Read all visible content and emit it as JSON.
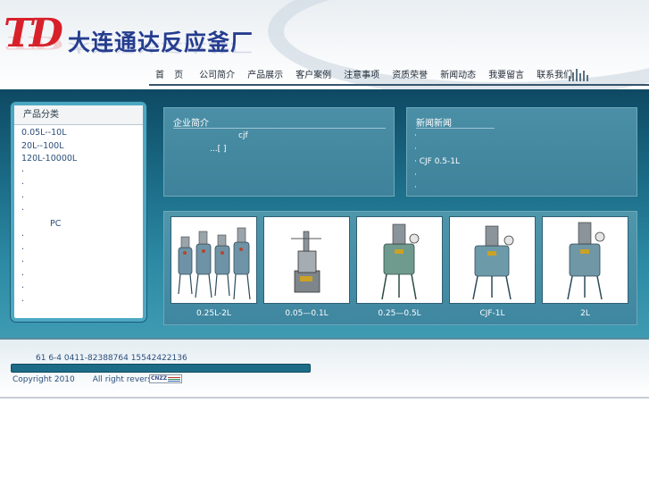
{
  "brand": {
    "logo_mark": "TD",
    "company_name": "大连通达反应釜厂"
  },
  "nav": {
    "items": [
      {
        "label": "首 页"
      },
      {
        "label": "公司简介"
      },
      {
        "label": "产品展示"
      },
      {
        "label": "客户案例"
      },
      {
        "label": "注意事项"
      },
      {
        "label": "资质荣誉"
      },
      {
        "label": "新闻动态"
      },
      {
        "label": "我要留言"
      },
      {
        "label": "联系我们"
      }
    ]
  },
  "categories": {
    "title": "产品分类",
    "items": [
      {
        "label": "0.05L--10L"
      },
      {
        "label": "20L--100L"
      },
      {
        "label": "120L-10000L"
      },
      {
        "label": "·"
      },
      {
        "label": "·"
      },
      {
        "label": "·"
      },
      {
        "label": "·"
      },
      {
        "label": "PC"
      },
      {
        "label": "·"
      },
      {
        "label": "·"
      },
      {
        "label": "·"
      },
      {
        "label": "·"
      },
      {
        "label": "·"
      },
      {
        "label": "·"
      }
    ]
  },
  "intro": {
    "title": "企业简介",
    "line1": "cjf",
    "more": "...[ ]"
  },
  "news": {
    "title": "新闻新闻",
    "items": [
      {
        "label": "·"
      },
      {
        "label": "·"
      },
      {
        "label": "·  CJF  0.5-1L"
      },
      {
        "label": "·"
      },
      {
        "label": "·"
      }
    ]
  },
  "products": [
    {
      "caption": "0.25L-2L"
    },
    {
      "caption": "0.05—0.1L"
    },
    {
      "caption": "0.25—0.5L"
    },
    {
      "caption": "CJF-1L"
    },
    {
      "caption": "2L"
    }
  ],
  "footer": {
    "address_phone": "61 6-4        0411-82388764  15542422136",
    "copyright": "Copyright 2010",
    "rights": "All right reversed.",
    "counter_badge": "CNZZ"
  },
  "colors": {
    "brand_red": "#d8202a",
    "brand_blue": "#253d8f",
    "band_teal": "#1a6a85"
  },
  "icons": [
    "equalizer-bars-icon"
  ]
}
